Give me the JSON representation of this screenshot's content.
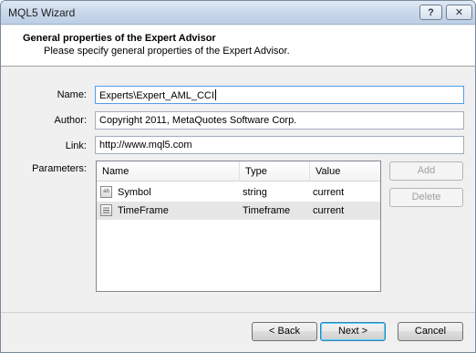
{
  "window": {
    "title": "MQL5 Wizard",
    "help_glyph": "?",
    "close_glyph": "✕"
  },
  "header": {
    "title": "General properties of the Expert Advisor",
    "subtitle": "Please specify general properties of the Expert Advisor."
  },
  "form": {
    "name_label": "Name:",
    "name_value": "Experts\\Expert_AML_CCI",
    "author_label": "Author:",
    "author_value": "Copyright 2011, MetaQuotes Software Corp.",
    "link_label": "Link:",
    "link_value": "http://www.mql5.com",
    "parameters_label": "Parameters:"
  },
  "parameters": {
    "columns": [
      "Name",
      "Type",
      "Value"
    ],
    "rows": [
      {
        "icon": "ab",
        "name": "Symbol",
        "type": "string",
        "value": "current"
      },
      {
        "icon": "",
        "name": "TimeFrame",
        "type": "Timeframe",
        "value": "current"
      }
    ],
    "selected_row": 1
  },
  "side_buttons": {
    "add": "Add",
    "delete": "Delete"
  },
  "nav_buttons": {
    "back": "< Back",
    "next": "Next >",
    "cancel": "Cancel"
  }
}
